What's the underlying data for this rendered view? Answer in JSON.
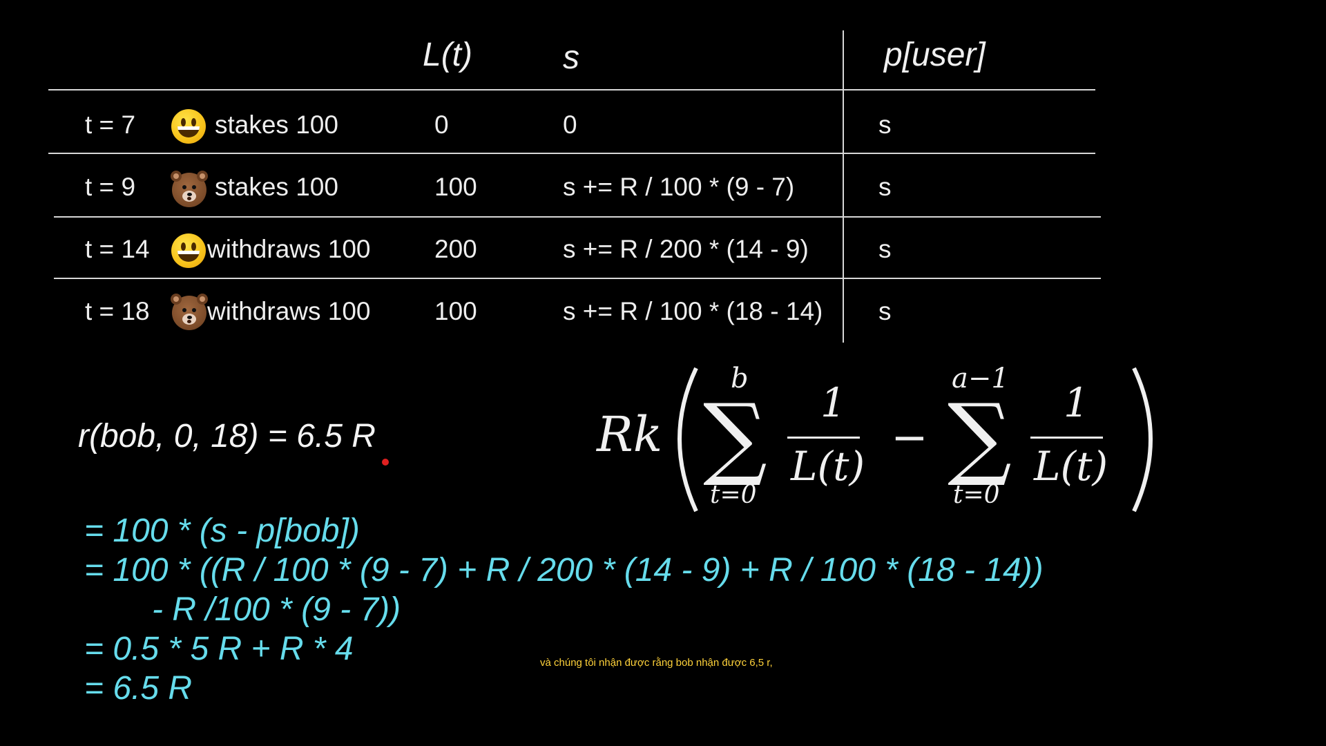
{
  "table": {
    "headers": {
      "lt": "L(t)",
      "s": "s",
      "puser": "p[user]"
    },
    "rows": [
      {
        "t": "t = 7",
        "avatar": "grinning-face-icon",
        "action": "stakes 100",
        "lt": "0",
        "s": "0",
        "p": "s"
      },
      {
        "t": "t = 9",
        "avatar": "bear-face-icon",
        "action": "stakes 100",
        "lt": "100",
        "s": "s += R / 100 * (9 - 7)",
        "p": "s"
      },
      {
        "t": "t = 14",
        "avatar": "grinning-face-icon",
        "action": "withdraws 100",
        "lt": "200",
        "s": "s += R / 200 * (14 - 9)",
        "p": "s"
      },
      {
        "t": "t = 18",
        "avatar": "bear-face-icon",
        "action": "withdraws 100",
        "lt": "100",
        "s": "s += R / 100 * (18 - 14)",
        "p": "s"
      }
    ]
  },
  "reward_lhs": "r(bob, 0, 18) = 6.5 R",
  "formula": {
    "prefix": "Rk",
    "sum1_upper": "b",
    "sum1_lower": "t=0",
    "frac_num": "1",
    "frac_den": "L(t)",
    "minus": "−",
    "sum2_upper": "a−1",
    "sum2_lower": "t=0"
  },
  "derivation": [
    "= 100 * (s - p[bob])",
    "= 100 * ((R / 100 * (9 - 7) + R / 200 * (14 - 9) + R / 100 * (18 - 14))",
    "- R /100 * (9 - 7))",
    "= 0.5 * 5 R + R * 4",
    "= 6.5 R"
  ],
  "caption": "và chúng tôi nhận được rằng bob nhận được 6,5 r,",
  "colors": {
    "background": "#000000",
    "text": "#f2f2f2",
    "derivation": "#66dcec",
    "caption": "#ffd23a",
    "pointer": "#e02020"
  }
}
